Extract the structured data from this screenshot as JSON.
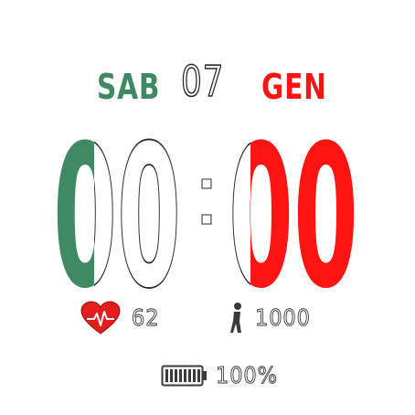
{
  "date": {
    "weekday": "SAB",
    "day": "07",
    "month": "GEN"
  },
  "time": {
    "hours": "00",
    "minutes": "00"
  },
  "heart_rate": {
    "icon": "heart-icon",
    "value": "62"
  },
  "steps": {
    "icon": "steps-icon",
    "value": "1000"
  },
  "battery": {
    "icon": "battery-icon",
    "level": 1.0,
    "value": "100%"
  },
  "colors": {
    "green": "#3f8a63",
    "white": "#ffffff",
    "red": "#ff1414",
    "outline": "#2a2a2a"
  }
}
